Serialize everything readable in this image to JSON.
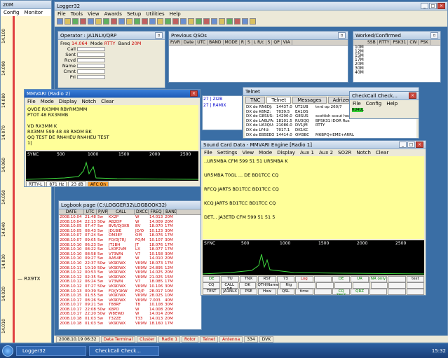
{
  "bandmap": {
    "title": "20M",
    "menu": [
      "Config",
      "Monitor"
    ],
    "freqs": [
      "14.100",
      "14.090",
      "14.080",
      "14.070",
      "14.060",
      "14.050",
      "14.040",
      "14.030",
      "14.020",
      "14.010"
    ],
    "spot": "RX9TX",
    "colors": {
      "band": "#fff6d0",
      "active": "#e04040"
    }
  },
  "logger": {
    "title": "Logger32",
    "menu": [
      "File",
      "Tools",
      "View",
      "Awards",
      "Setup",
      "Utilities",
      "Help"
    ]
  },
  "operator": {
    "title": "Operator : JA1NLX/QRP",
    "freq_label": "Freq",
    "freq": "14.064",
    "mode_label": "Mode",
    "mode": "RTTY",
    "band_label": "Band",
    "band": "20M",
    "fields": [
      "Call",
      "Sent",
      "Rcvd",
      "Name",
      "Cmnt",
      "Pri"
    ],
    "field1": "field 1",
    "pvr": "P/VR",
    "pvr_val": "5w",
    "via": "VIA",
    "sec": "Sec",
    "q": "?"
  },
  "prevqsos": {
    "title": "Previous QSOs",
    "cols": [
      "P/VR",
      "Date",
      "UTC",
      "BAND",
      "MODE",
      "R",
      "S",
      "L R/c",
      "S",
      "QP",
      "VIA"
    ]
  },
  "worked": {
    "title": "Worked/Confirmed",
    "cols": [
      "SSB",
      "RTTY",
      "PSK31",
      "CW",
      "PSK"
    ],
    "bands": [
      "10M",
      "12M",
      "15M",
      "17M",
      "20M",
      "30M",
      "40M"
    ]
  },
  "mmvari2": {
    "title": "MMVARI (Radio 2)",
    "menu": [
      "File",
      "Mode",
      "Display",
      "Notch",
      "Clear"
    ],
    "text": [
      "QVDE RX3MM RBYRM3MM",
      "PTOT 48 RX3MMB",
      "",
      "VD RX3MM  K",
      "RX3MM 599 48 48 RXOM BK",
      "QQ TEST DE RN4HEU RN4HEU TEST",
      "1|"
    ],
    "sync": "SYNC",
    "scale": [
      "500",
      "1000",
      "1500",
      "2000",
      "2500"
    ],
    "status": [
      "RTTY-L",
      "871 Hz",
      "23 dB",
      "AFC On"
    ]
  },
  "telnet": {
    "title": "Telnet",
    "tabs": [
      "TNC",
      "Telnet",
      "Messages",
      "Adrizer"
    ],
    "rows": [
      [
        "DX de RN6DJ:",
        "14437.0",
        "UT2UB",
        "tnrd op 260/7"
      ],
      [
        "DX de K6NZ:",
        "7039.5",
        "EA1OS",
        ""
      ],
      [
        "DX de G8SUS:",
        "14290.0",
        "G8SUS",
        "scottish scout head"
      ],
      [
        "DX de LA6LFA:",
        "18101.5",
        "RU3QQ",
        "BPSK31 IDOR Rus"
      ],
      [
        "DX de UA3QU:",
        "21086.0",
        "DV1JM",
        "RTTY"
      ],
      [
        "DX de LY4U:",
        "7017.1",
        "DK1KC",
        ""
      ],
      [
        "DX de EB5EEO:",
        "14414.0",
        "OM3BC",
        "M6BPQ+EME+ARRL"
      ]
    ]
  },
  "checkcall": {
    "title": "CheckCall  Check...",
    "menu": [
      "File",
      "Config",
      "Help"
    ],
    "value": "RU4UL"
  },
  "soundcard": {
    "title": "Sound Card Data - MMVARI Engine [Radio 1]",
    "menu": [
      "File",
      "Settings",
      "View",
      "Mode",
      "Display",
      "Aux 1",
      "Aux 2",
      "SO2R",
      "Notch",
      "Clear"
    ],
    "lines": [
      "..UR5MBA CFM 599 51 51 UR5MBA K",
      "",
      "UR5MBA T0GL ... DE BD1TCC CQ",
      "",
      "RFCQ JARTS BD1TCC BD1TCC CQ",
      "",
      "KCQ JARTS BD1TCC BD1TCC CQ",
      "",
      "DET... JA3ETD CFM 599 51 51 5"
    ],
    "sync": "SYNC",
    "scale": [
      "500",
      "1000",
      "1500",
      "2000",
      "2500"
    ],
    "macros": [
      [
        "DE",
        "TU",
        "TNX",
        "RST",
        "73",
        "Log",
        "",
        "DE",
        "UR",
        "NR only",
        "",
        "test"
      ],
      [
        "CQ",
        "CALL DE",
        "DK",
        "QTH/Name",
        "Rig",
        "",
        "",
        "",
        "",
        "",
        "",
        ""
      ],
      [
        "TEST",
        "JA1NLX",
        "PSE",
        "How",
        "QSL",
        "time",
        "",
        "CQ TEST",
        "QRZ",
        "",
        "",
        ""
      ]
    ],
    "status": [
      "RTTY-L",
      "1000 Hz",
      "14082.290 KHz",
      "19 dB",
      "Samples",
      "Receive",
      "Net On",
      "AFC Off",
      "",
      "Abort",
      "PTT"
    ]
  },
  "logbook": {
    "title": "Logbook page (C:\\LOGGER32\\LOGBOOK32)",
    "cols": [
      "DATE",
      "UTC",
      "P/VR",
      "CALL",
      "DXCC",
      "FREQ",
      "BAND"
    ],
    "rows": [
      [
        "2008.10.04",
        "21:48",
        "5w",
        "KX2P",
        "W",
        "14.013",
        "20M"
      ],
      [
        "2008.10.04",
        "22:13",
        "50w",
        "AB2DP",
        "W",
        "14.009",
        "20M"
      ],
      [
        "2008.10.05",
        "07:47",
        "5w",
        "BV5/DJ3KR",
        "BV",
        "18.070",
        "17M"
      ],
      [
        "2008.10.05",
        "08:43",
        "5w",
        "JD1BIE",
        "JD/O",
        "10.123",
        "30M"
      ],
      [
        "2008.10.07",
        "07:24",
        "5w",
        "OM3EY",
        "OM",
        "18.076",
        "17M"
      ],
      [
        "2008.10.07",
        "09:05",
        "5w",
        "FO/DJ7RJ",
        "FO/M",
        "10.107",
        "30M"
      ],
      [
        "2008.10.10",
        "06:23",
        "5w",
        "JT1BH",
        "JT",
        "18.076",
        "17M"
      ],
      [
        "2008.10.10",
        "08:22",
        "5w",
        "LX0F2VM",
        "LX",
        "18.077",
        "17M"
      ],
      [
        "2008.10.10",
        "08:58",
        "5w",
        "V73WN",
        "V7",
        "10.158",
        "30M"
      ],
      [
        "2008.10.10",
        "09:27",
        "5w",
        "AA54E",
        "W",
        "14.010",
        "20M"
      ],
      [
        "2008.10.10",
        "22:37",
        "50w",
        "VK9DWX",
        "VK9W",
        "18.073",
        "17M"
      ],
      [
        "2008.10.11",
        "10:10",
        "50w",
        "VK9DWX",
        "VK9W",
        "24.895",
        "12M"
      ],
      [
        "2008.10.12",
        "00:53",
        "5w",
        "VK9DWX",
        "VK9W",
        "14.025",
        "20M"
      ],
      [
        "2008.10.12",
        "02:35",
        "5w",
        "VK9DWX",
        "VK9W",
        "21.025",
        "15M"
      ],
      [
        "2008.10.12",
        "06:24",
        "5w",
        "V73WN",
        "V7",
        "18.085",
        "17M"
      ],
      [
        "2008.10.12",
        "07:27",
        "50w",
        "VK9DWX",
        "VK9W",
        "10.106",
        "30M"
      ],
      [
        "2008.10.13",
        "00:39",
        "5w",
        "FO/JY1KW",
        "FO/P",
        "28.017",
        "10M"
      ],
      [
        "2008.10.15",
        "01:55",
        "5w",
        "VK9DWX",
        "VK9W",
        "28.025",
        "10M"
      ],
      [
        "2008.10.17",
        "08:26",
        "5w",
        "VK9DWX",
        "VK9W",
        "7.003",
        "40M"
      ],
      [
        "2008.10.17",
        "09:21",
        "5w",
        "T88RF",
        "T8",
        "10.108",
        "30M"
      ],
      [
        "2008.10.17",
        "22:08",
        "50w",
        "K8PO",
        "W",
        "14.008",
        "20M"
      ],
      [
        "2008.10.17",
        "22:20",
        "50w",
        "W8EWD",
        "W",
        "14.014",
        "20M"
      ],
      [
        "2008.10.18",
        "01:03",
        "5w",
        "T32ZE",
        "T33",
        "14.013",
        "20M"
      ],
      [
        "2008.10.18",
        "01:03",
        "5w",
        "VK9DWX",
        "VK9W",
        "18.160",
        "17M"
      ]
    ]
  },
  "statusbar": {
    "items": [
      "2008.10.19  06:32",
      "Data Terminal",
      "Cluster",
      "Radio 1",
      "Rotor",
      "Telnet",
      "Antenna",
      "334",
      "DVK"
    ]
  },
  "taskbar": {
    "items": [
      "Logger32",
      "CheckCall  Check..."
    ],
    "clock": "15:32"
  }
}
